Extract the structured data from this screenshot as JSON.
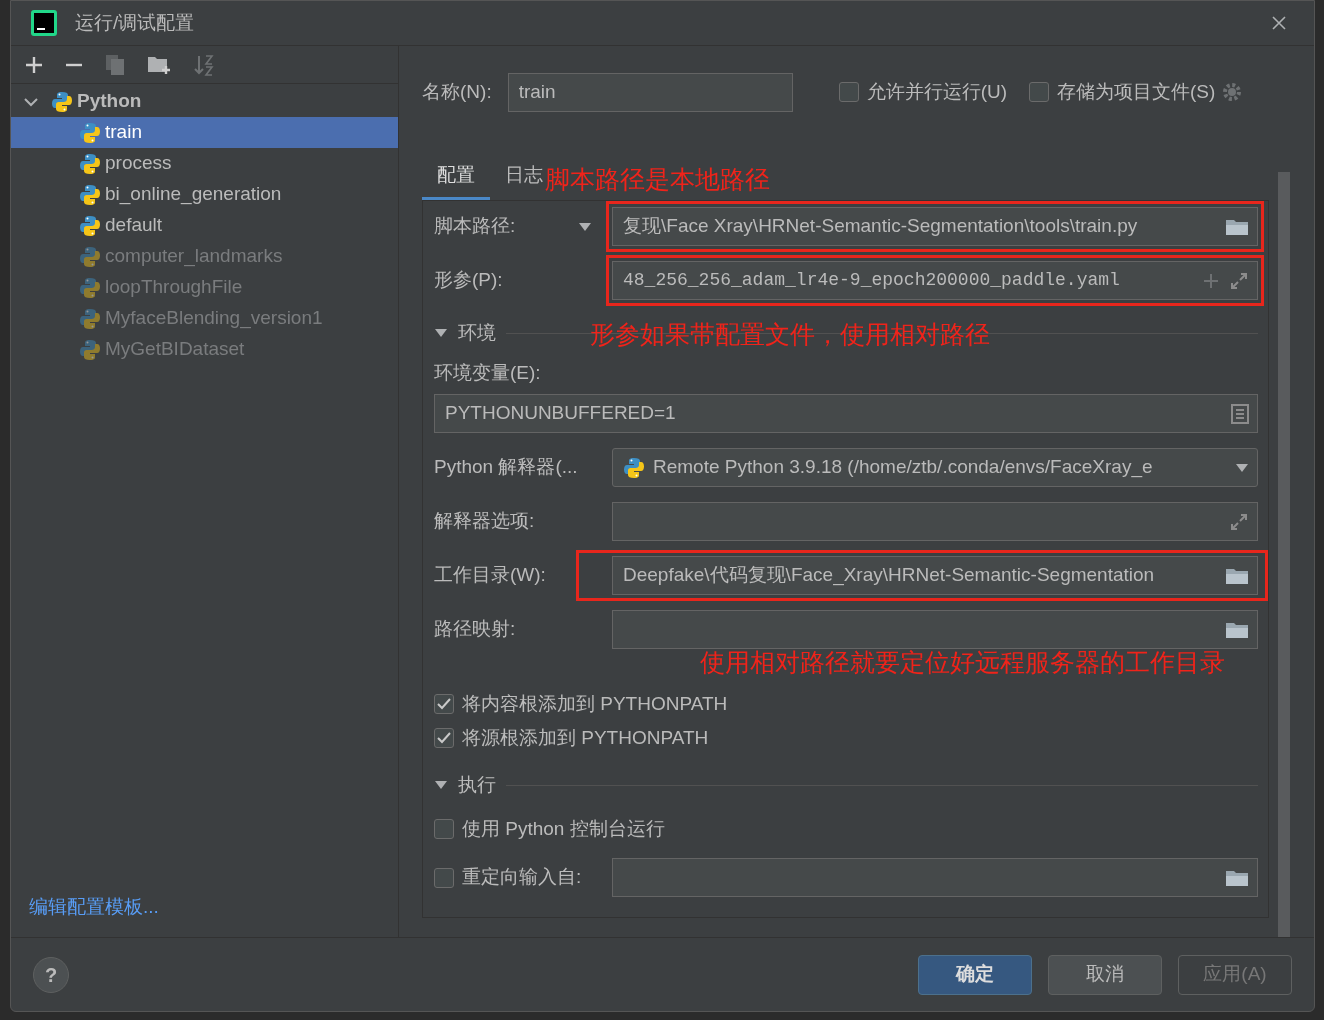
{
  "window": {
    "title": "运行/调试配置"
  },
  "tree": {
    "label": "Python",
    "expanded": true,
    "children": [
      {
        "label": "train",
        "selected": true,
        "disabled": false
      },
      {
        "label": "process",
        "selected": false,
        "disabled": false
      },
      {
        "label": "bi_online_generation",
        "selected": false,
        "disabled": false
      },
      {
        "label": "default",
        "selected": false,
        "disabled": false
      },
      {
        "label": "computer_landmarks",
        "selected": false,
        "disabled": true
      },
      {
        "label": "loopThroughFile",
        "selected": false,
        "disabled": true
      },
      {
        "label": "MyfaceBlending_version1",
        "selected": false,
        "disabled": true
      },
      {
        "label": "MyGetBIDataset",
        "selected": false,
        "disabled": true
      }
    ]
  },
  "edit_templates_link": "编辑配置模板...",
  "name": {
    "label": "名称(N):",
    "value": "train"
  },
  "top_options": [
    {
      "label": "允许并行运行(U)",
      "checked": false
    },
    {
      "label": "存储为项目文件(S)",
      "checked": false
    }
  ],
  "tabs": [
    {
      "label": "配置",
      "selected": true
    },
    {
      "label": "日志",
      "selected": false
    }
  ],
  "script_path": {
    "label": "脚本路径:",
    "value": "复现\\Face Xray\\HRNet-Semantic-Segmentation\\tools\\train.py"
  },
  "parameters": {
    "label": "形参(P):",
    "value": "48_256_256_adam_lr4e-9_epoch200000_paddle.yaml"
  },
  "environment": {
    "title": "环境",
    "expanded": true,
    "env_label": "环境变量(E):",
    "env_value": "PYTHONUNBUFFERED=1",
    "interpreter_label": "Python 解释器(...",
    "interpreter_value": "Remote Python 3.9.18 (/home/ztb/.conda/envs/FaceXray_e",
    "interpreter_options_label": "解释器选项:",
    "workdir_label": "工作目录(W):",
    "workdir_value": "Deepfake\\代码复现\\Face_Xray\\HRNet-Semantic-Segmentation",
    "path_mappings_label": "路径映射:",
    "checks": [
      {
        "label": "将内容根添加到 PYTHONPATH",
        "checked": true
      },
      {
        "label": "将源根添加到 PYTHONPATH",
        "checked": true
      }
    ]
  },
  "execution": {
    "title": "执行",
    "expanded": true,
    "checks": [
      {
        "label": "使用 Python 控制台运行",
        "checked": false
      },
      {
        "label": "重定向输入自:",
        "checked": false
      }
    ]
  },
  "annotations": [
    {
      "text": "脚本路径是本地路径"
    },
    {
      "text": "形参如果带配置文件，使用相对路径"
    },
    {
      "text": "使用相对路径就要定位好远程服务器的工作目录"
    }
  ],
  "help_label": "?",
  "buttons": [
    {
      "label": "确定",
      "kind": "primary"
    },
    {
      "label": "取消",
      "kind": "default"
    },
    {
      "label": "应用(A)",
      "kind": "disabled"
    }
  ]
}
